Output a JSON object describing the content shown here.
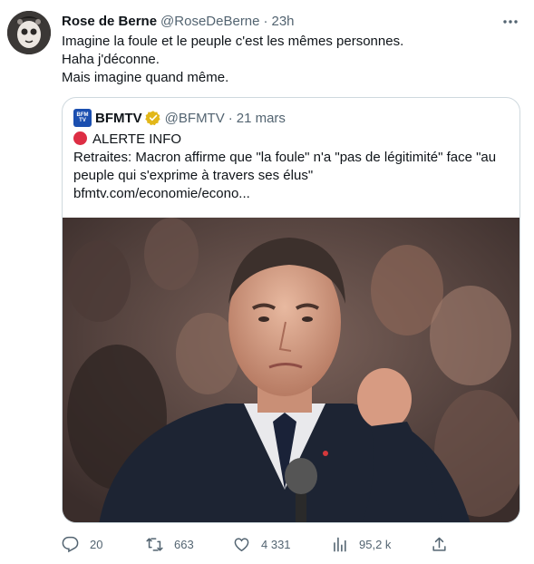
{
  "author": {
    "name": "Rose de Berne",
    "handle": "@RoseDeBerne",
    "separator": "·",
    "time": "23h"
  },
  "tweet": {
    "lines": [
      "Imagine la foule et le peuple c'est les mêmes personnes.",
      "Haha j'déconne.",
      "Mais imagine quand même."
    ]
  },
  "quote": {
    "logo_text": "BFM TV",
    "name": "BFMTV",
    "handle": "@BFMTV",
    "separator": "·",
    "time": "21 mars",
    "alert": "ALERTE INFO",
    "text_lines": [
      "Retraites: Macron affirme que \"la foule\" n'a \"pas de légitimité\" face \"au",
      "peuple qui s'exprime à travers ses élus\"",
      "bfmtv.com/economie/econo..."
    ]
  },
  "actions": {
    "replies": "20",
    "retweets": "663",
    "likes": "4 331",
    "views": "95,2 k"
  },
  "colors": {
    "text": "#0f1419",
    "secondary": "#536471",
    "border": "#cfd9de",
    "verified_gold": "#e2b719",
    "alert_red": "#dd2e44",
    "bfm_blue": "#1b4fb0"
  },
  "icons": [
    "more-icon",
    "verified-icon",
    "reply-icon",
    "retweet-icon",
    "like-icon",
    "views-icon",
    "share-icon"
  ]
}
